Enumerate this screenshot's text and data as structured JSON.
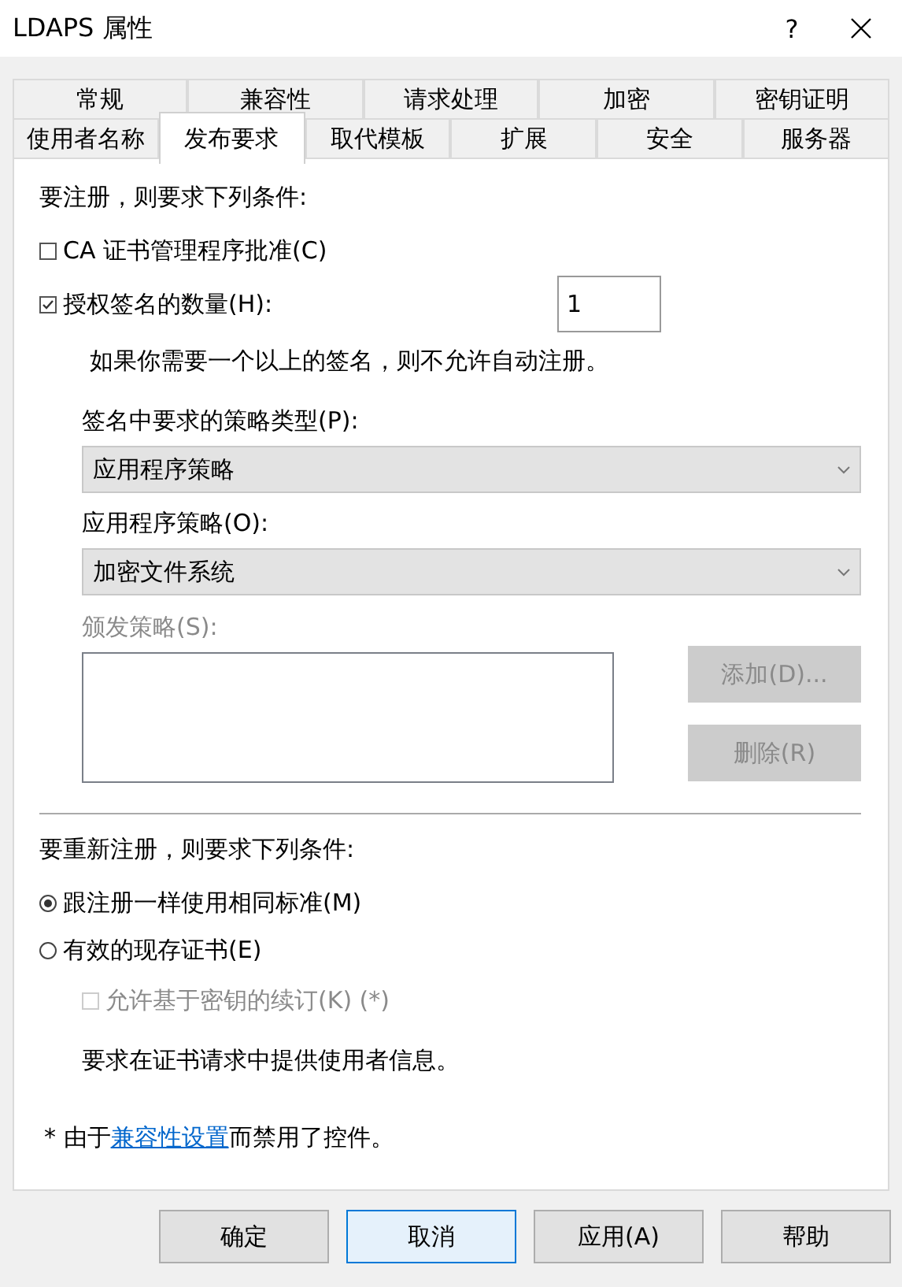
{
  "window": {
    "title": "LDAPS 属性",
    "help_button": "?"
  },
  "tabs": [
    [
      {
        "label": "常规",
        "selected": false
      },
      {
        "label": "兼容性",
        "selected": false
      },
      {
        "label": "请求处理",
        "selected": false
      },
      {
        "label": "加密",
        "selected": false
      },
      {
        "label": "密钥证明",
        "selected": false
      }
    ],
    [
      {
        "label": "使用者名称",
        "selected": false
      },
      {
        "label": "发布要求",
        "selected": true
      },
      {
        "label": "取代模板",
        "selected": false
      },
      {
        "label": "扩展",
        "selected": false
      },
      {
        "label": "安全",
        "selected": false
      },
      {
        "label": "服务器",
        "selected": false
      }
    ]
  ],
  "enrollment": {
    "heading": "要注册，则要求下列条件:",
    "checkboxes": [
      {
        "label": "CA 证书管理程序批准(C)",
        "checked": false
      },
      {
        "label": "授权签名的数量(H):",
        "checked": true
      }
    ],
    "signature_count": "1",
    "note": "如果你需要一个以上的签名，则不允许自动注册。",
    "policy_type_label": "签名中要求的策略类型(P):",
    "policy_type": "应用程序策略",
    "application_policy_label": "应用程序策略(O):",
    "application_policy": "加密文件系统",
    "issuance_policy_label": "颁发策略(S):",
    "issuance_disabled": true,
    "buttons": [
      {
        "label": "添加(D)...",
        "disabled": true
      },
      {
        "label": "删除(R)",
        "disabled": true
      }
    ]
  },
  "reenrollment": {
    "heading": "要重新注册，则要求下列条件:",
    "radios": [
      {
        "label": "跟注册一样使用相同标准(M)",
        "selected": true
      },
      {
        "label": "有效的现存证书(E)",
        "selected": false
      }
    ],
    "key_renewal": {
      "label": "允许基于密钥的续订(K) (*)",
      "checked": false,
      "disabled": true
    },
    "info": "要求在证书请求中提供使用者信息。"
  },
  "footnote": {
    "prefix": "* 由于",
    "link": "兼容性设置",
    "suffix": "而禁用了控件。"
  },
  "buttons": [
    {
      "label": "确定",
      "focused": false
    },
    {
      "label": "取消",
      "focused": true
    },
    {
      "label": "应用(A)",
      "focused": false
    },
    {
      "label": "帮助",
      "focused": false
    }
  ]
}
